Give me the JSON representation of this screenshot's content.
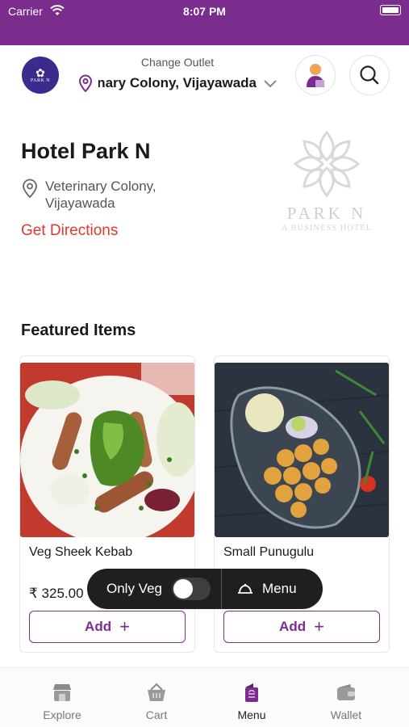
{
  "status": {
    "carrier": "Carrier",
    "time": "8:07 PM"
  },
  "header": {
    "logo_text": "PARK N",
    "change_outlet_label": "Change Outlet",
    "outlet_name": "Veterinary Colony, Vijayawada"
  },
  "hotel": {
    "name": "Hotel Park N",
    "address_line1": "Veterinary Colony,",
    "address_line2": "Vijayawada",
    "directions_label": "Get Directions",
    "watermark_name": "PARK N",
    "watermark_tagline": "A BUSINESS HOTEL"
  },
  "featured": {
    "title": "Featured Items",
    "items": [
      {
        "name": "Veg Sheek Kebab",
        "price": "₹ 325.00",
        "add_label": "Add"
      },
      {
        "name": "Small Punugulu",
        "price": "",
        "add_label": "Add"
      }
    ]
  },
  "floating": {
    "veg_label": "Only Veg",
    "veg_enabled": false,
    "menu_label": "Menu"
  },
  "tabs": [
    {
      "label": "Explore",
      "icon": "store-icon"
    },
    {
      "label": "Cart",
      "icon": "basket-icon"
    },
    {
      "label": "Menu",
      "icon": "menu-book-icon",
      "active": true
    },
    {
      "label": "Wallet",
      "icon": "wallet-icon"
    }
  ],
  "colors": {
    "brand": "#7b2d8e",
    "link": "#e0392d",
    "float_bar": "#1f1f1f"
  }
}
